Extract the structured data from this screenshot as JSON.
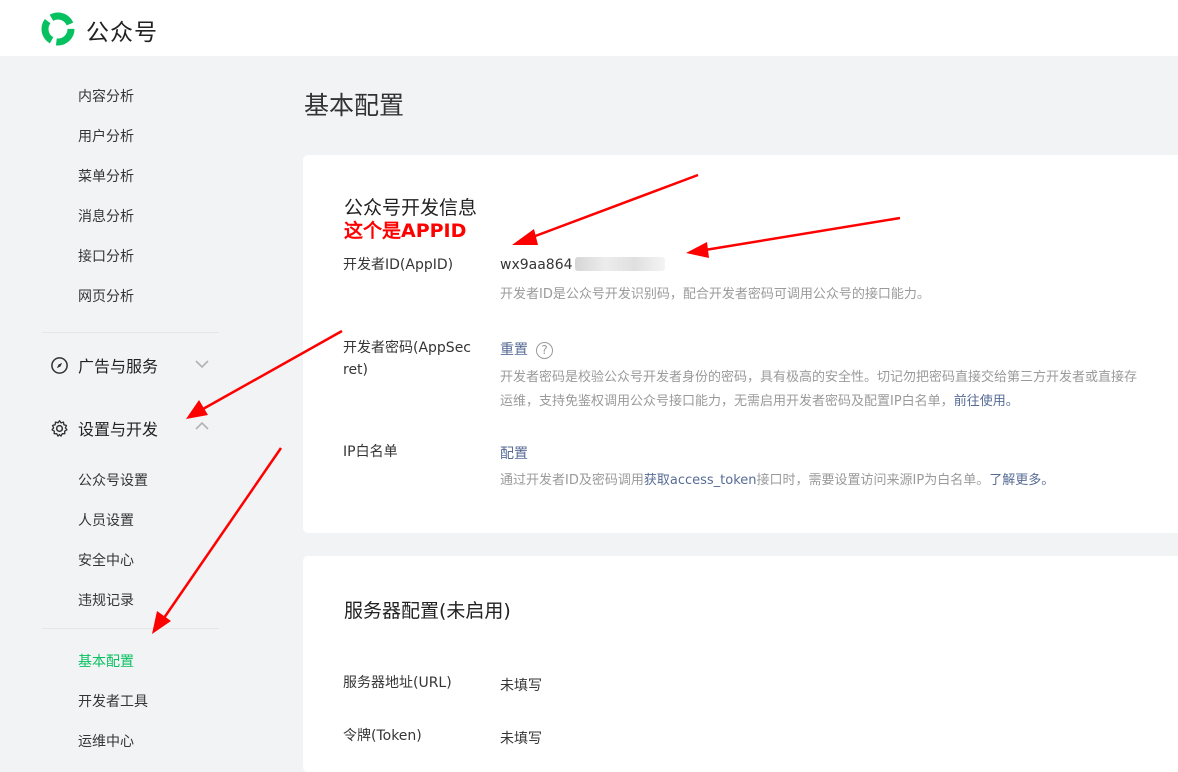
{
  "header": {
    "brand": "公众号",
    "logo_icon": "wechat-official-account-logo-icon"
  },
  "sidebar": {
    "analytics_items": [
      "内容分析",
      "用户分析",
      "菜单分析",
      "消息分析",
      "接口分析",
      "网页分析"
    ],
    "group_ads": {
      "label": "广告与服务",
      "icon": "compass-icon",
      "chevron": "chevron-down-icon"
    },
    "group_settings": {
      "label": "设置与开发",
      "icon": "gear-icon",
      "chevron": "chevron-up-icon"
    },
    "settings_items": [
      "公众号设置",
      "人员设置",
      "安全中心",
      "违规记录"
    ],
    "dev_items": [
      "基本配置",
      "开发者工具",
      "运维中心"
    ],
    "active_item": "基本配置",
    "active_color": "#07c160"
  },
  "main": {
    "page_title": "基本配置",
    "dev_info": {
      "title": "公众号开发信息",
      "annotation": "这个是APPID",
      "appid": {
        "label": "开发者ID(AppID)",
        "value": "wx9aa864",
        "desc": "开发者ID是公众号开发识别码，配合开发者密码可调用公众号的接口能力。"
      },
      "appsecret": {
        "label_line1": "开发者密码(AppSec",
        "label_line2": "ret)",
        "action": "重置",
        "help_icon": "question-circle-icon",
        "desc_line1": "开发者密码是校验公众号开发者身份的密码，具有极高的安全性。切记勿把密码直接交给第三方开发者或直接存",
        "desc_line2": "运维，支持免鉴权调用公众号接口能力，无需启用开发者密码及配置IP白名单，",
        "desc_link": "前往使用。"
      },
      "ip_whitelist": {
        "label": "IP白名单",
        "action": "配置",
        "desc_pre": "通过开发者ID及密码调用",
        "desc_dark": "获取access_token",
        "desc_post": "接口时，需要设置访问来源IP为白名单。",
        "desc_link": "了解更多。"
      }
    },
    "server_config": {
      "title": "服务器配置(未启用)",
      "url_label": "服务器地址(URL)",
      "url_value": "未填写",
      "token_label": "令牌(Token)",
      "token_value": "未填写"
    },
    "annotation_color": "#ff0000",
    "link_color": "#576b95"
  }
}
